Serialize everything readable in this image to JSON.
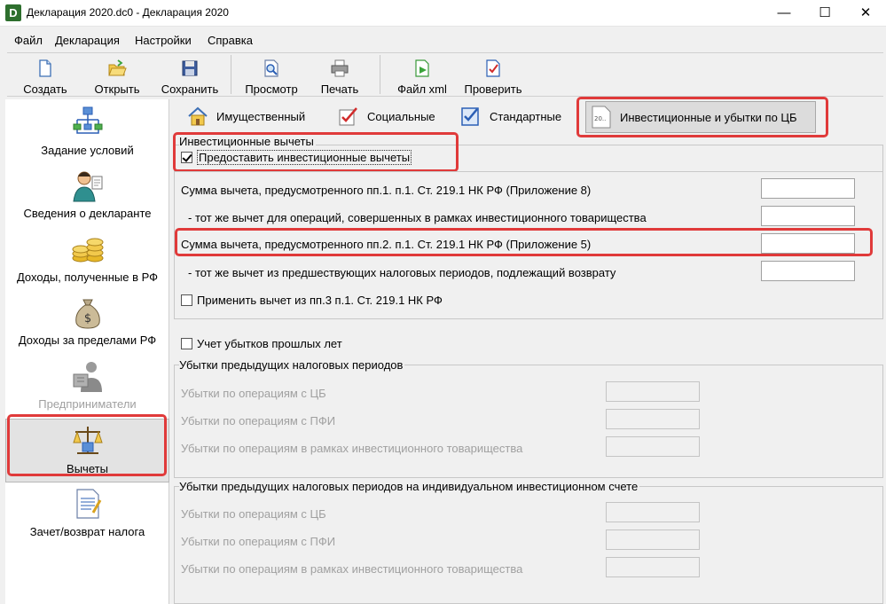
{
  "window": {
    "title": "Декларация 2020.dc0 - Декларация 2020",
    "app_icon_letter": "D",
    "minimize": "—",
    "maximize": "☐",
    "close": "✕"
  },
  "menu": [
    "Файл",
    "Декларация",
    "Настройки",
    "Справка"
  ],
  "toolbar": [
    {
      "label": "Создать",
      "icon": "new-file-icon"
    },
    {
      "label": "Открыть",
      "icon": "open-folder-icon"
    },
    {
      "label": "Сохранить",
      "icon": "save-disk-icon"
    },
    {
      "label": "Просмотр",
      "icon": "preview-icon"
    },
    {
      "label": "Печать",
      "icon": "printer-icon"
    },
    {
      "label": "Файл xml",
      "icon": "xml-file-icon"
    },
    {
      "label": "Проверить",
      "icon": "check-document-icon"
    }
  ],
  "sidebar": [
    {
      "label": "Задание условий",
      "icon": "conditions-tree-icon",
      "state": "normal"
    },
    {
      "label": "Сведения о декларанте",
      "icon": "declarant-person-icon",
      "state": "normal"
    },
    {
      "label": "Доходы, полученные в РФ",
      "icon": "coins-icon",
      "state": "normal"
    },
    {
      "label": "Доходы за пределами РФ",
      "icon": "money-bag-icon",
      "state": "normal"
    },
    {
      "label": "Предприниматели",
      "icon": "entrepreneur-icon",
      "state": "disabled"
    },
    {
      "label": "Вычеты",
      "icon": "scales-icon",
      "state": "active"
    },
    {
      "label": "Зачет/возврат налога",
      "icon": "tax-document-icon",
      "state": "normal"
    }
  ],
  "tabs": [
    {
      "label": "Имущественный",
      "icon": "house-icon"
    },
    {
      "label": "Социальные",
      "icon": "social-check-icon"
    },
    {
      "label": "Стандартные",
      "icon": "standard-check-icon"
    },
    {
      "label": "Инвестиционные и убытки по ЦБ",
      "icon": "securities-document-icon",
      "icon_text": "20..",
      "active": true
    }
  ],
  "invest": {
    "legend": "Инвестиционные вычеты",
    "provide_checkbox": {
      "label": "Предоставить инвестиционные вычеты",
      "checked": true
    },
    "rows": [
      {
        "label": "Сумма вычета, предусмотренного пп.1. п.1. Ст. 219.1 НК РФ (Приложение 8)",
        "value": ""
      },
      {
        "label": "- тот же вычет для операций, совершенных в рамках инвестиционного товарищества",
        "value": ""
      },
      {
        "label": "Сумма вычета, предусмотренного пп.2. п.1. Ст. 219.1 НК РФ (Приложение 5)",
        "value": ""
      },
      {
        "label": "- тот же вычет из предшествующих налоговых периодов, подлежащий возврату",
        "value": ""
      }
    ],
    "apply_checkbox": {
      "label": "Применить вычет из пп.3 п.1. Ст. 219.1 НК РФ",
      "checked": false
    }
  },
  "losses": {
    "checkbox": {
      "label": "Учет убытков прошлых лет",
      "checked": false
    },
    "group1": {
      "legend": "Убытки предыдущих налоговых периодов",
      "rows": [
        {
          "label": "Убытки по операциям с ЦБ",
          "value": ""
        },
        {
          "label": "Убытки по операциям с ПФИ",
          "value": ""
        },
        {
          "label": "Убытки по операциям в рамках инвестиционного товарищества",
          "value": ""
        }
      ]
    },
    "group2": {
      "legend": "Убытки предыдущих налоговых периодов на индивидуальном инвестиционном счете",
      "rows": [
        {
          "label": "Убытки по операциям с ЦБ",
          "value": ""
        },
        {
          "label": "Убытки по операциям с ПФИ",
          "value": ""
        },
        {
          "label": "Убытки по операциям в рамках инвестиционного товарищества",
          "value": ""
        }
      ]
    }
  },
  "colors": {
    "highlight": "#e03a3a",
    "accent_blue": "#2b5fb5"
  }
}
